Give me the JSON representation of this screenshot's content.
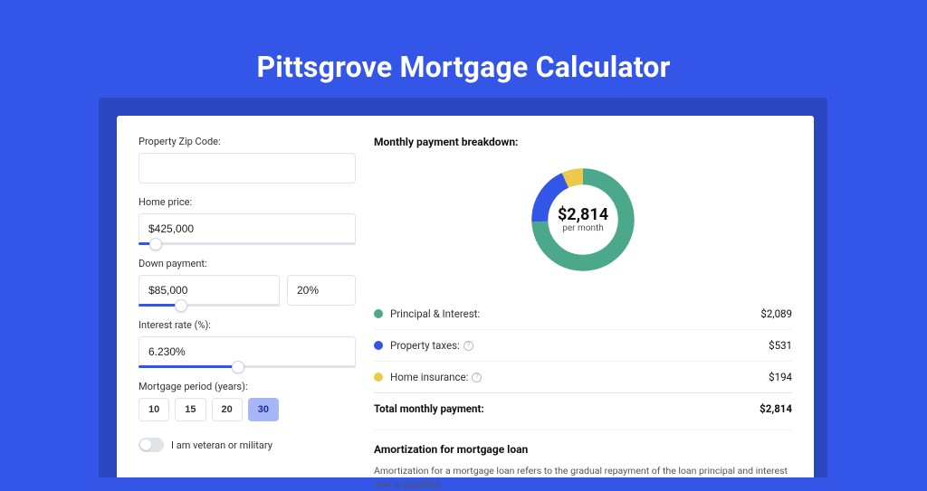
{
  "hero": {
    "title": "Pittsgrove Mortgage Calculator"
  },
  "form": {
    "zip_label": "Property Zip Code:",
    "zip_value": "",
    "home_price_label": "Home price:",
    "home_price_value": "$425,000",
    "home_price_slider_pct": 8,
    "down_payment_label": "Down payment:",
    "down_payment_value": "$85,000",
    "down_payment_pct_value": "20%",
    "down_payment_slider_pct": 30,
    "interest_label": "Interest rate (%):",
    "interest_value": "6.230%",
    "interest_slider_pct": 46,
    "period_label": "Mortgage period (years):",
    "periods": [
      "10",
      "15",
      "20",
      "30"
    ],
    "period_active_index": 3,
    "veteran_label": "I am veteran or military"
  },
  "breakdown": {
    "title": "Monthly payment breakdown:",
    "total": "$2,814",
    "per_month": "per month",
    "items": [
      {
        "label": "Principal & Interest:",
        "value": "$2,089",
        "color": "#4ba88a",
        "info": false,
        "fraction": 0.742
      },
      {
        "label": "Property taxes:",
        "value": "$531",
        "color": "#3355e8",
        "info": true,
        "fraction": 0.189
      },
      {
        "label": "Home insurance:",
        "value": "$194",
        "color": "#ecc94b",
        "info": true,
        "fraction": 0.069
      }
    ],
    "total_row_label": "Total monthly payment:",
    "total_row_value": "$2,814"
  },
  "amort": {
    "title": "Amortization for mortgage loan",
    "text": "Amortization for a mortgage loan refers to the gradual repayment of the loan principal and interest over a specified"
  },
  "chart_data": {
    "type": "pie",
    "title": "Monthly payment breakdown",
    "categories": [
      "Principal & Interest",
      "Property taxes",
      "Home insurance"
    ],
    "values": [
      2089,
      531,
      194
    ],
    "colors": [
      "#4ba88a",
      "#3355e8",
      "#ecc94b"
    ],
    "total": 2814,
    "unit": "USD per month"
  }
}
